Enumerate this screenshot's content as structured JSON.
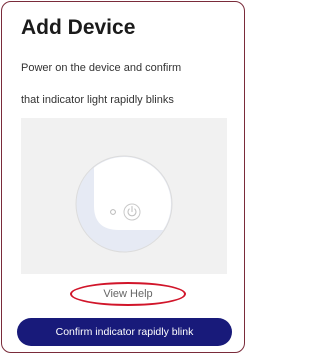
{
  "page": {
    "title": "Add Device",
    "instruction_line1": "Power on the device and confirm",
    "instruction_line2": "that indicator light rapidly blinks"
  },
  "illustration": {
    "icon": "device-power-indicator-icon"
  },
  "help": {
    "label": "View Help"
  },
  "actions": {
    "confirm_label": "Confirm indicator rapidly blink"
  },
  "colors": {
    "border": "#7a2b3a",
    "highlight_oval": "#d1152a",
    "primary_button": "#181a7a",
    "illustration_bg": "#f1f1f1"
  }
}
